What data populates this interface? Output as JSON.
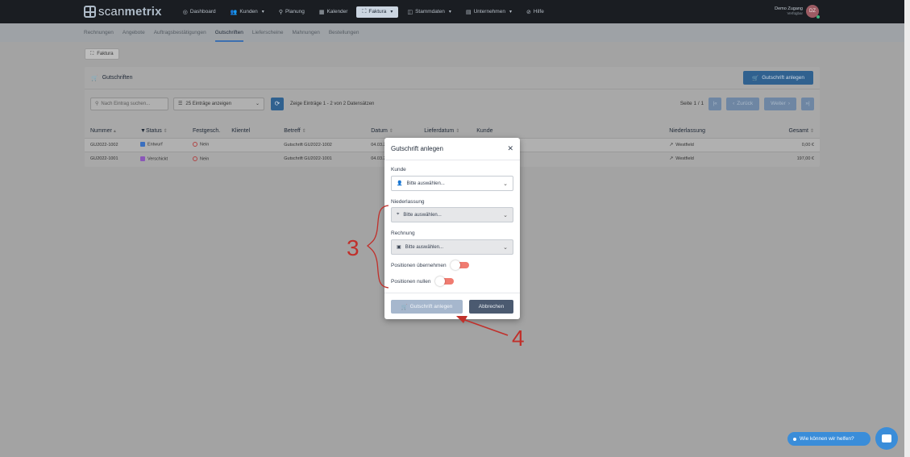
{
  "app": {
    "logo_scan": "scan",
    "logo_metrix": "metrix"
  },
  "nav": [
    {
      "label": "Dashboard",
      "icon": "dashboard-icon",
      "glyph": "◎",
      "chev": ""
    },
    {
      "label": "Kunden",
      "icon": "users-icon",
      "glyph": "👥",
      "chev": "▾"
    },
    {
      "label": "Planung",
      "icon": "planning-icon",
      "glyph": "⚲",
      "chev": ""
    },
    {
      "label": "Kalender",
      "icon": "calendar-icon",
      "glyph": "▦",
      "chev": ""
    },
    {
      "label": "Faktura",
      "icon": "invoice-icon",
      "glyph": "⛶",
      "chev": "▾",
      "active": true
    },
    {
      "label": "Stammdaten",
      "icon": "database-icon",
      "glyph": "◫",
      "chev": "▾"
    },
    {
      "label": "Unternehmen",
      "icon": "company-icon",
      "glyph": "▤",
      "chev": "▾"
    },
    {
      "label": "Hilfe",
      "icon": "help-icon",
      "glyph": "⊘",
      "chev": ""
    }
  ],
  "user": {
    "name": "Demo Zugang",
    "role": "Verfügbar",
    "initials": "DZ"
  },
  "subnav": [
    "Rechnungen",
    "Angebote",
    "Auftragsbestätigungen",
    "Gutschriften",
    "Lieferscheine",
    "Mahnungen",
    "Bestellungen"
  ],
  "subnav_active": 3,
  "crumb": "Faktura",
  "card": {
    "title": "Gutschriften",
    "create_button": "Gutschrift anlegen"
  },
  "toolbar": {
    "search_placeholder": "Nach Eintrag suchen...",
    "page_size": "25 Einträge anzeigen",
    "info": "Zeige Einträge 1 - 2 von 2 Datensätzen",
    "page": "Seite 1 / 1",
    "first": "|«",
    "prev": "Zurück",
    "next": "Weiter",
    "last": "»|"
  },
  "table": {
    "headers": [
      "Nummer",
      "Status",
      "Festgesch.",
      "Klientel",
      "Betreff",
      "Datum",
      "Lieferdatum",
      "Kunde",
      "Niederlassung",
      "Gesamt"
    ],
    "rows": [
      {
        "nummer": "GU2022-1002",
        "status": "Entwurf",
        "status_color": "#3a6fbf",
        "fest": "Nein",
        "betreff": "Gutschrift GU2022-1002",
        "datum": "04.03.20",
        "niederlassung": "Westfield",
        "gesamt": "0,00 €"
      },
      {
        "nummer": "GU2022-1001",
        "status": "Verschickt",
        "status_color": "#8a57b8",
        "fest": "Nein",
        "betreff": "Gutschrift GU2022-1001",
        "datum": "04.03.20",
        "niederlassung": "Westfield",
        "gesamt": "197,00 €"
      }
    ]
  },
  "modal": {
    "title": "Gutschrift anlegen",
    "kunde_label": "Kunde",
    "kunde_placeholder": "Bitte auswählen...",
    "niederlassung_label": "Niederlassung",
    "niederlassung_placeholder": "Bitte auswählen...",
    "rechnung_label": "Rechnung",
    "rechnung_placeholder": "Bitte auswählen...",
    "toggle1": "Positionen übernehmen",
    "toggle2": "Positionen nullen",
    "submit": "Gutschrift anlegen",
    "cancel": "Abbrechen"
  },
  "annotations": {
    "n3": "3",
    "n4": "4"
  },
  "help": {
    "label": "Wie können wir helfen?"
  },
  "colors": {
    "accent": "#30618f",
    "annotation": "#c0302b",
    "toggle_off": "#f07b70"
  }
}
